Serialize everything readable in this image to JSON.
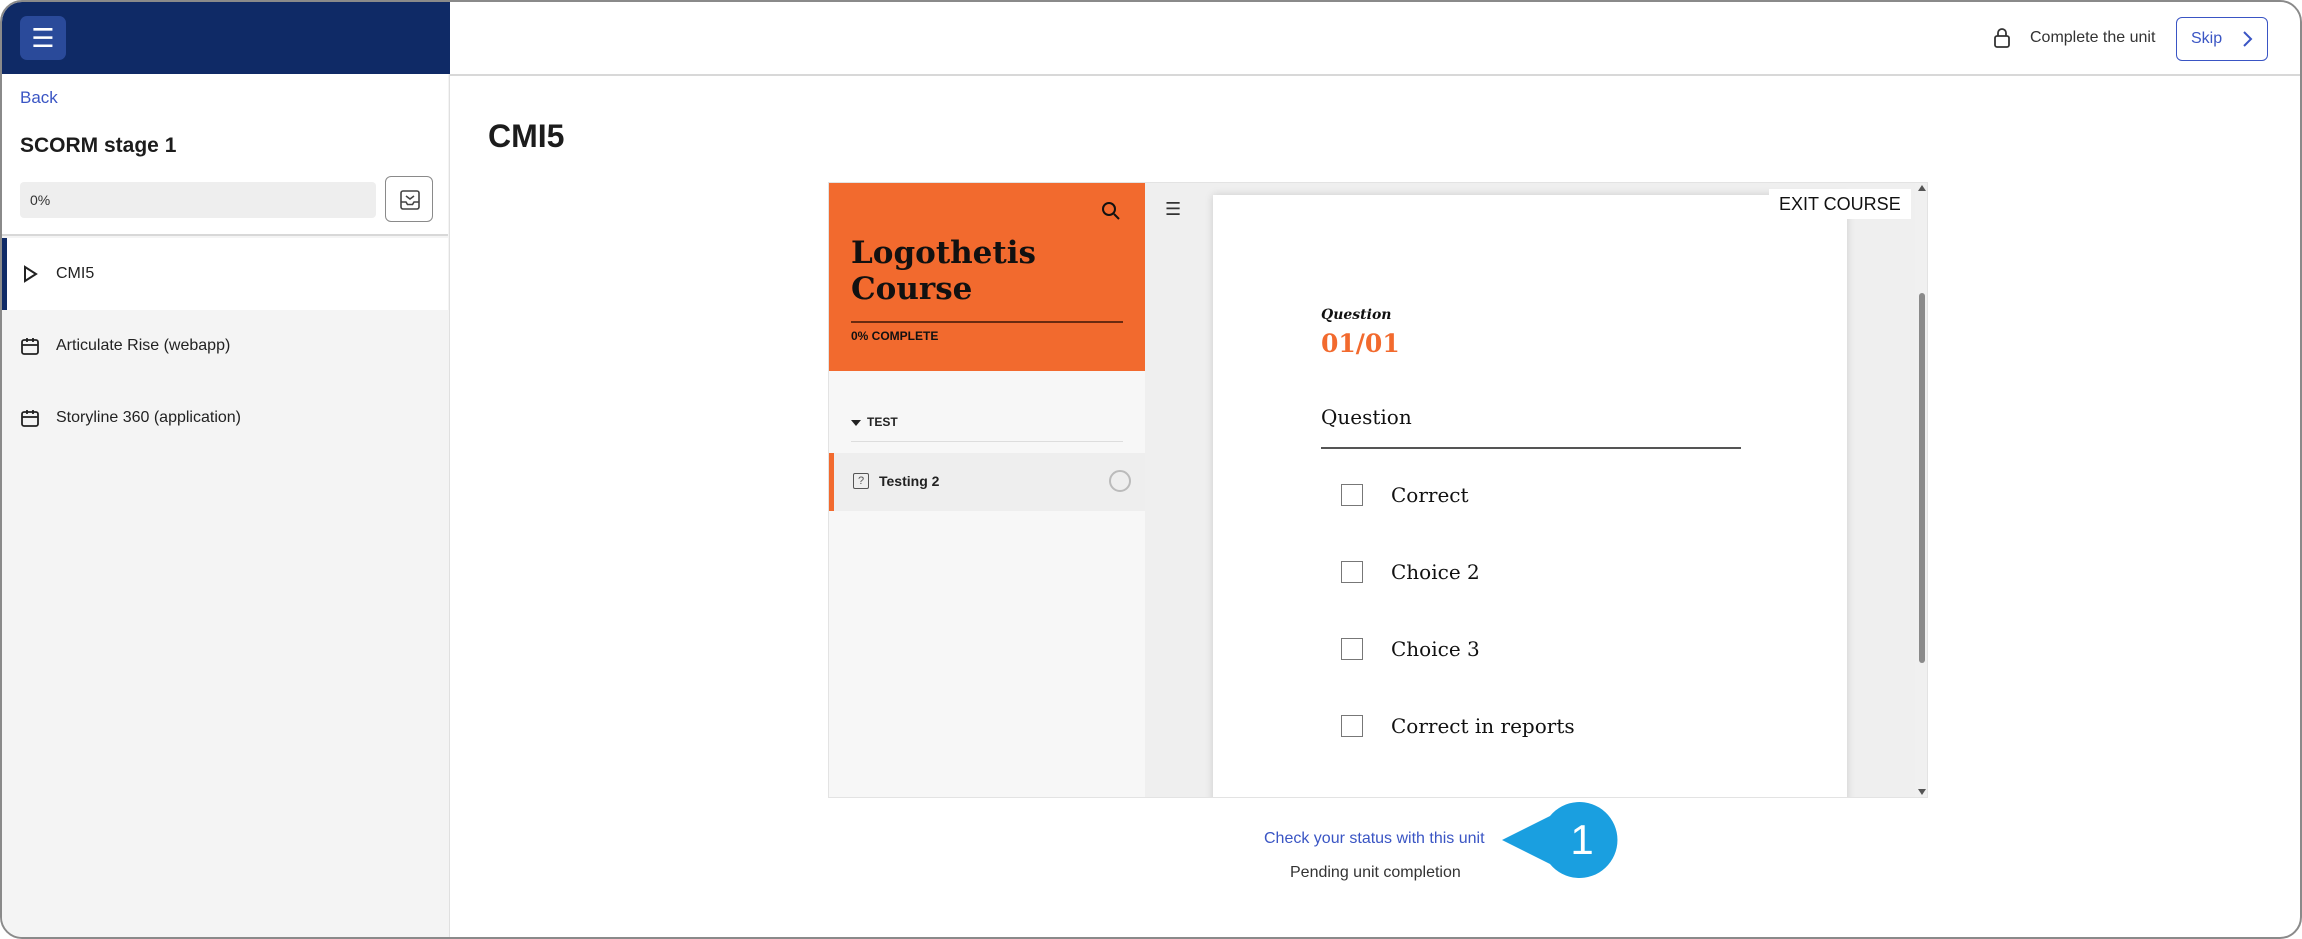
{
  "sidebar": {
    "back_label": "Back",
    "stage_title": "SCORM stage 1",
    "progress_text": "0%",
    "progress_value": 0,
    "items": [
      {
        "label": "CMI5",
        "icon": "play-icon",
        "active": true
      },
      {
        "label": "Articulate Rise (webapp)",
        "icon": "package-icon",
        "active": false
      },
      {
        "label": "Storyline 360 (application)",
        "icon": "package-icon",
        "active": false
      }
    ]
  },
  "topbar": {
    "complete_label": "Complete the unit",
    "skip_label": "Skip"
  },
  "main": {
    "title": "CMI5"
  },
  "player": {
    "course_title": "Logothetis Course",
    "course_progress": "0% COMPLETE",
    "section_label": "TEST",
    "lesson_label": "Testing 2",
    "exit_label": "EXIT COURSE",
    "question_eyebrow": "Question",
    "question_number": "01/01",
    "question_text": "Question",
    "choices": [
      "Correct",
      "Choice 2",
      "Choice 3",
      "Correct in reports"
    ]
  },
  "footer": {
    "status_link": "Check your status with this unit",
    "pending_text": "Pending unit completion"
  },
  "callout": {
    "number": "1"
  },
  "colors": {
    "sidebar_header": "#0f2a66",
    "accent_link": "#3a55c4",
    "course_orange": "#f26a2e",
    "callout_blue": "#1a9fe0"
  }
}
